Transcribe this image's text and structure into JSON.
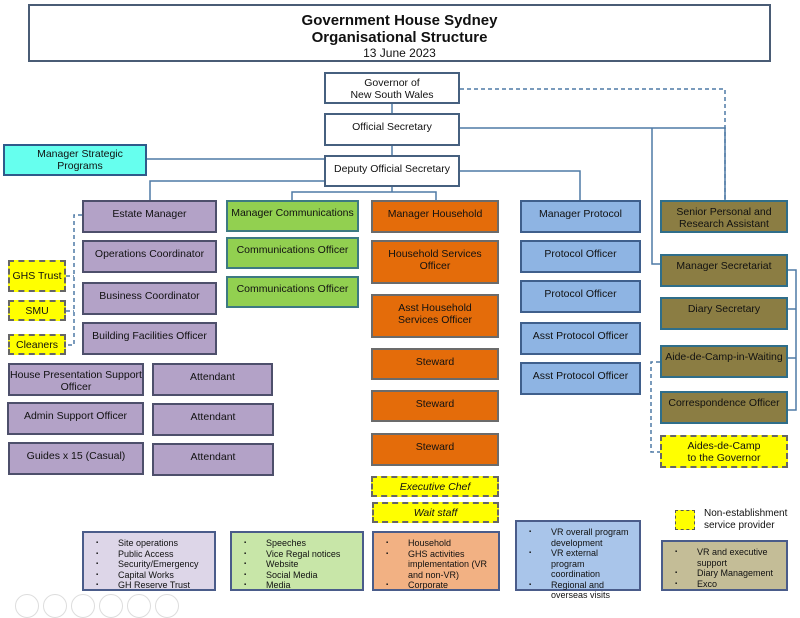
{
  "header": {
    "title": "Government House Sydney",
    "subtitle": "Organisational Structure",
    "date": "13 June 2023"
  },
  "top": {
    "governor": "Governor of\nNew South Wales",
    "official_secretary": "Official Secretary",
    "deputy_official_secretary": "Deputy Official Secretary",
    "manager_strategic_programs": "Manager Strategic Programs"
  },
  "estate": {
    "manager": "Estate Manager",
    "roles": [
      "Operations Coordinator",
      "Business Coordinator",
      "Building Facilities Officer"
    ],
    "providers": [
      "GHS Trust",
      "SMU",
      "Cleaners"
    ],
    "left_roles": [
      "House Presentation Support Officer",
      "Admin Support Officer",
      "Guides x 15 (Casual)"
    ],
    "attendants": [
      "Attendant",
      "Attendant",
      "Attendant"
    ],
    "responsibilities": [
      "Site operations",
      "Public Access",
      "Security/Emergency",
      "Capital Works",
      "GH Reserve Trust"
    ]
  },
  "communications": {
    "manager": "Manager Communications",
    "roles": [
      "Communications Officer",
      "Communications Officer"
    ],
    "responsibilities": [
      "Speeches",
      "Vice Regal notices",
      "Website",
      "Social Media",
      "Media"
    ]
  },
  "household": {
    "manager": "Manager Household",
    "roles": [
      "Household Services Officer",
      "Asst Household Services Officer",
      "Steward",
      "Steward",
      "Steward"
    ],
    "providers": [
      "Executive Chef",
      "Wait staff"
    ],
    "responsibilities": [
      "Household",
      "GHS activities implementation (VR and non-VR)",
      "Corporate"
    ]
  },
  "protocol": {
    "manager": "Manager Protocol",
    "roles": [
      "Protocol Officer",
      "Protocol Officer",
      "Asst Protocol Officer",
      "Asst Protocol Officer"
    ],
    "responsibilities": [
      "VR overall program development",
      "VR external program coordination",
      "Regional and overseas visits"
    ]
  },
  "secretariat": {
    "senior_assistant": "Senior Personal and Research Assistant",
    "manager": "Manager Secretariat",
    "roles": [
      "Diary Secretary",
      "Aide-de-Camp-in-Waiting",
      "Correspondence Officer"
    ],
    "provider": "Aides-de-Camp to the Governor",
    "responsibilities": [
      "VR and executive support",
      "Diary Management",
      "Exco"
    ]
  },
  "legend": {
    "label": "Non-establishment service provider"
  },
  "colors": {
    "estate": "#b3a2c7",
    "communications": "#92d050",
    "household": "#e46c0a",
    "protocol": "#8eb4e3",
    "secretariat": "#8b7d43",
    "strategic": "#66ffee",
    "provider": "#ffff00",
    "connector": "#4f7aa5"
  }
}
